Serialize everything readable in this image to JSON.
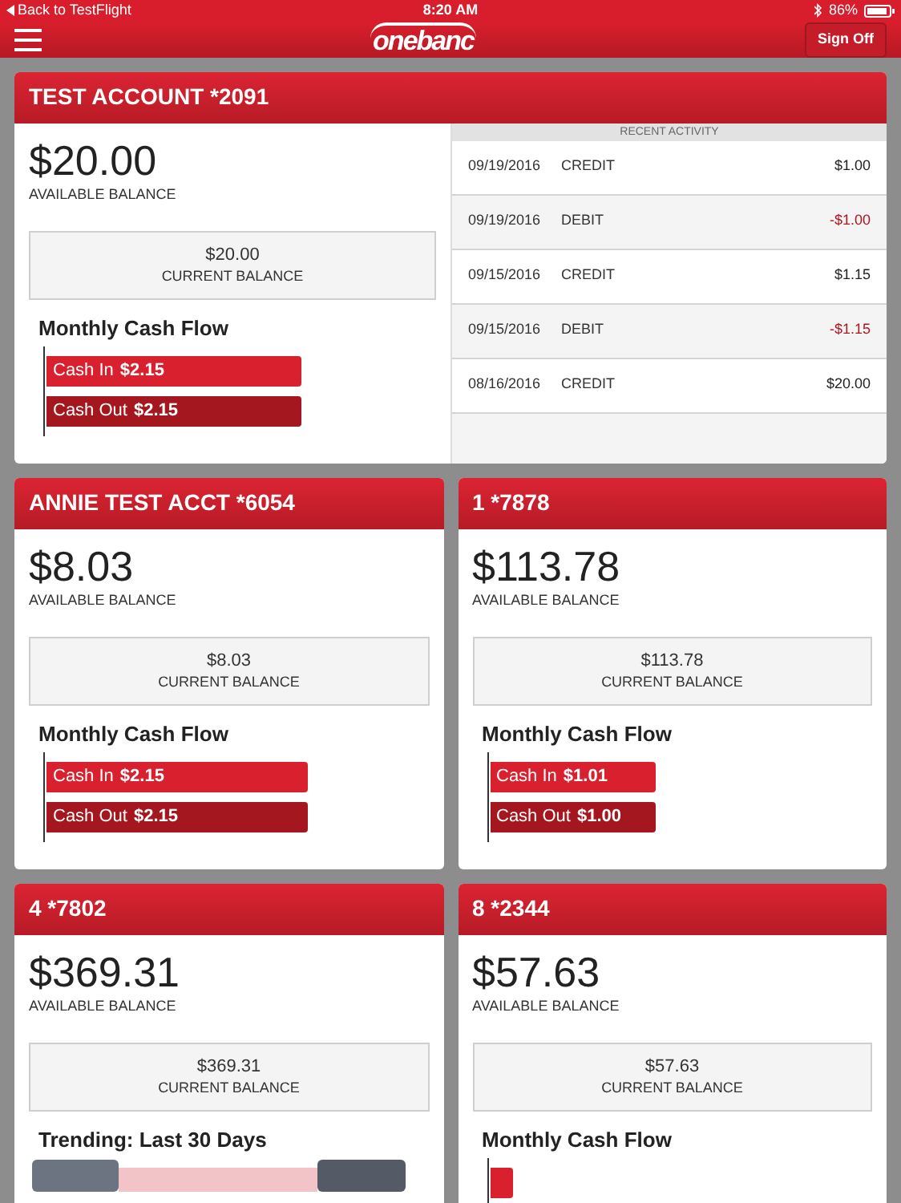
{
  "status_bar": {
    "back": "Back to TestFlight",
    "time": "8:20 AM",
    "battery": "86%"
  },
  "nav": {
    "logo": "onebanc",
    "sign_off": "Sign Off"
  },
  "accounts": [
    {
      "name": "TEST ACCOUNT *2091",
      "available": "$20.00",
      "available_label": "AVAILABLE BALANCE",
      "current": "$20.00",
      "current_label": "CURRENT BALANCE",
      "chart": {
        "kind": "cash_flow",
        "title": "Monthly Cash Flow",
        "bars": [
          {
            "label": "Cash In",
            "amount": "$2.15",
            "level": 0.68,
            "color": "#d8202f"
          },
          {
            "label": "Cash Out",
            "amount": "$2.15",
            "level": 0.68,
            "color": "#a5171f"
          }
        ]
      },
      "activity": {
        "title": "RECENT ACTIVITY",
        "rows": [
          {
            "date": "09/19/2016",
            "type": "CREDIT",
            "amount": "$1.00",
            "kind": "credit"
          },
          {
            "date": "09/19/2016",
            "type": "DEBIT",
            "amount": "-$1.00",
            "kind": "debit"
          },
          {
            "date": "09/15/2016",
            "type": "CREDIT",
            "amount": "$1.15",
            "kind": "credit"
          },
          {
            "date": "09/15/2016",
            "type": "DEBIT",
            "amount": "-$1.15",
            "kind": "debit"
          },
          {
            "date": "08/16/2016",
            "type": "CREDIT",
            "amount": "$20.00",
            "kind": "credit"
          }
        ]
      }
    },
    {
      "name": "ANNIE TEST ACCT *6054",
      "available": "$8.03",
      "available_label": "AVAILABLE BALANCE",
      "current": "$8.03",
      "current_label": "CURRENT BALANCE",
      "chart": {
        "kind": "cash_flow",
        "title": "Monthly Cash Flow",
        "bars": [
          {
            "label": "Cash In",
            "amount": "$2.15",
            "level": 0.71,
            "color": "#d8202f"
          },
          {
            "label": "Cash Out",
            "amount": "$2.15",
            "level": 0.71,
            "color": "#a5171f"
          }
        ]
      }
    },
    {
      "name": "1 *7878",
      "available": "$113.78",
      "available_label": "AVAILABLE BALANCE",
      "current": "$113.78",
      "current_label": "CURRENT BALANCE",
      "chart": {
        "kind": "cash_flow",
        "title": "Monthly Cash Flow",
        "bars": [
          {
            "label": "Cash In",
            "amount": "$1.01",
            "level": 0.45,
            "color": "#d8202f"
          },
          {
            "label": "Cash Out",
            "amount": "$1.00",
            "level": 0.45,
            "color": "#a5171f"
          }
        ]
      }
    },
    {
      "name": "4 *7802",
      "available": "$369.31",
      "available_label": "AVAILABLE BALANCE",
      "current": "$369.31",
      "current_label": "CURRENT BALANCE",
      "chart": {
        "kind": "trending",
        "title": "Trending: Last 30 Days"
      }
    },
    {
      "name": "8 *2344",
      "available": "$57.63",
      "available_label": "AVAILABLE BALANCE",
      "current": "$57.63",
      "current_label": "CURRENT BALANCE",
      "chart": {
        "kind": "cash_flow",
        "title": "Monthly Cash Flow"
      }
    }
  ]
}
